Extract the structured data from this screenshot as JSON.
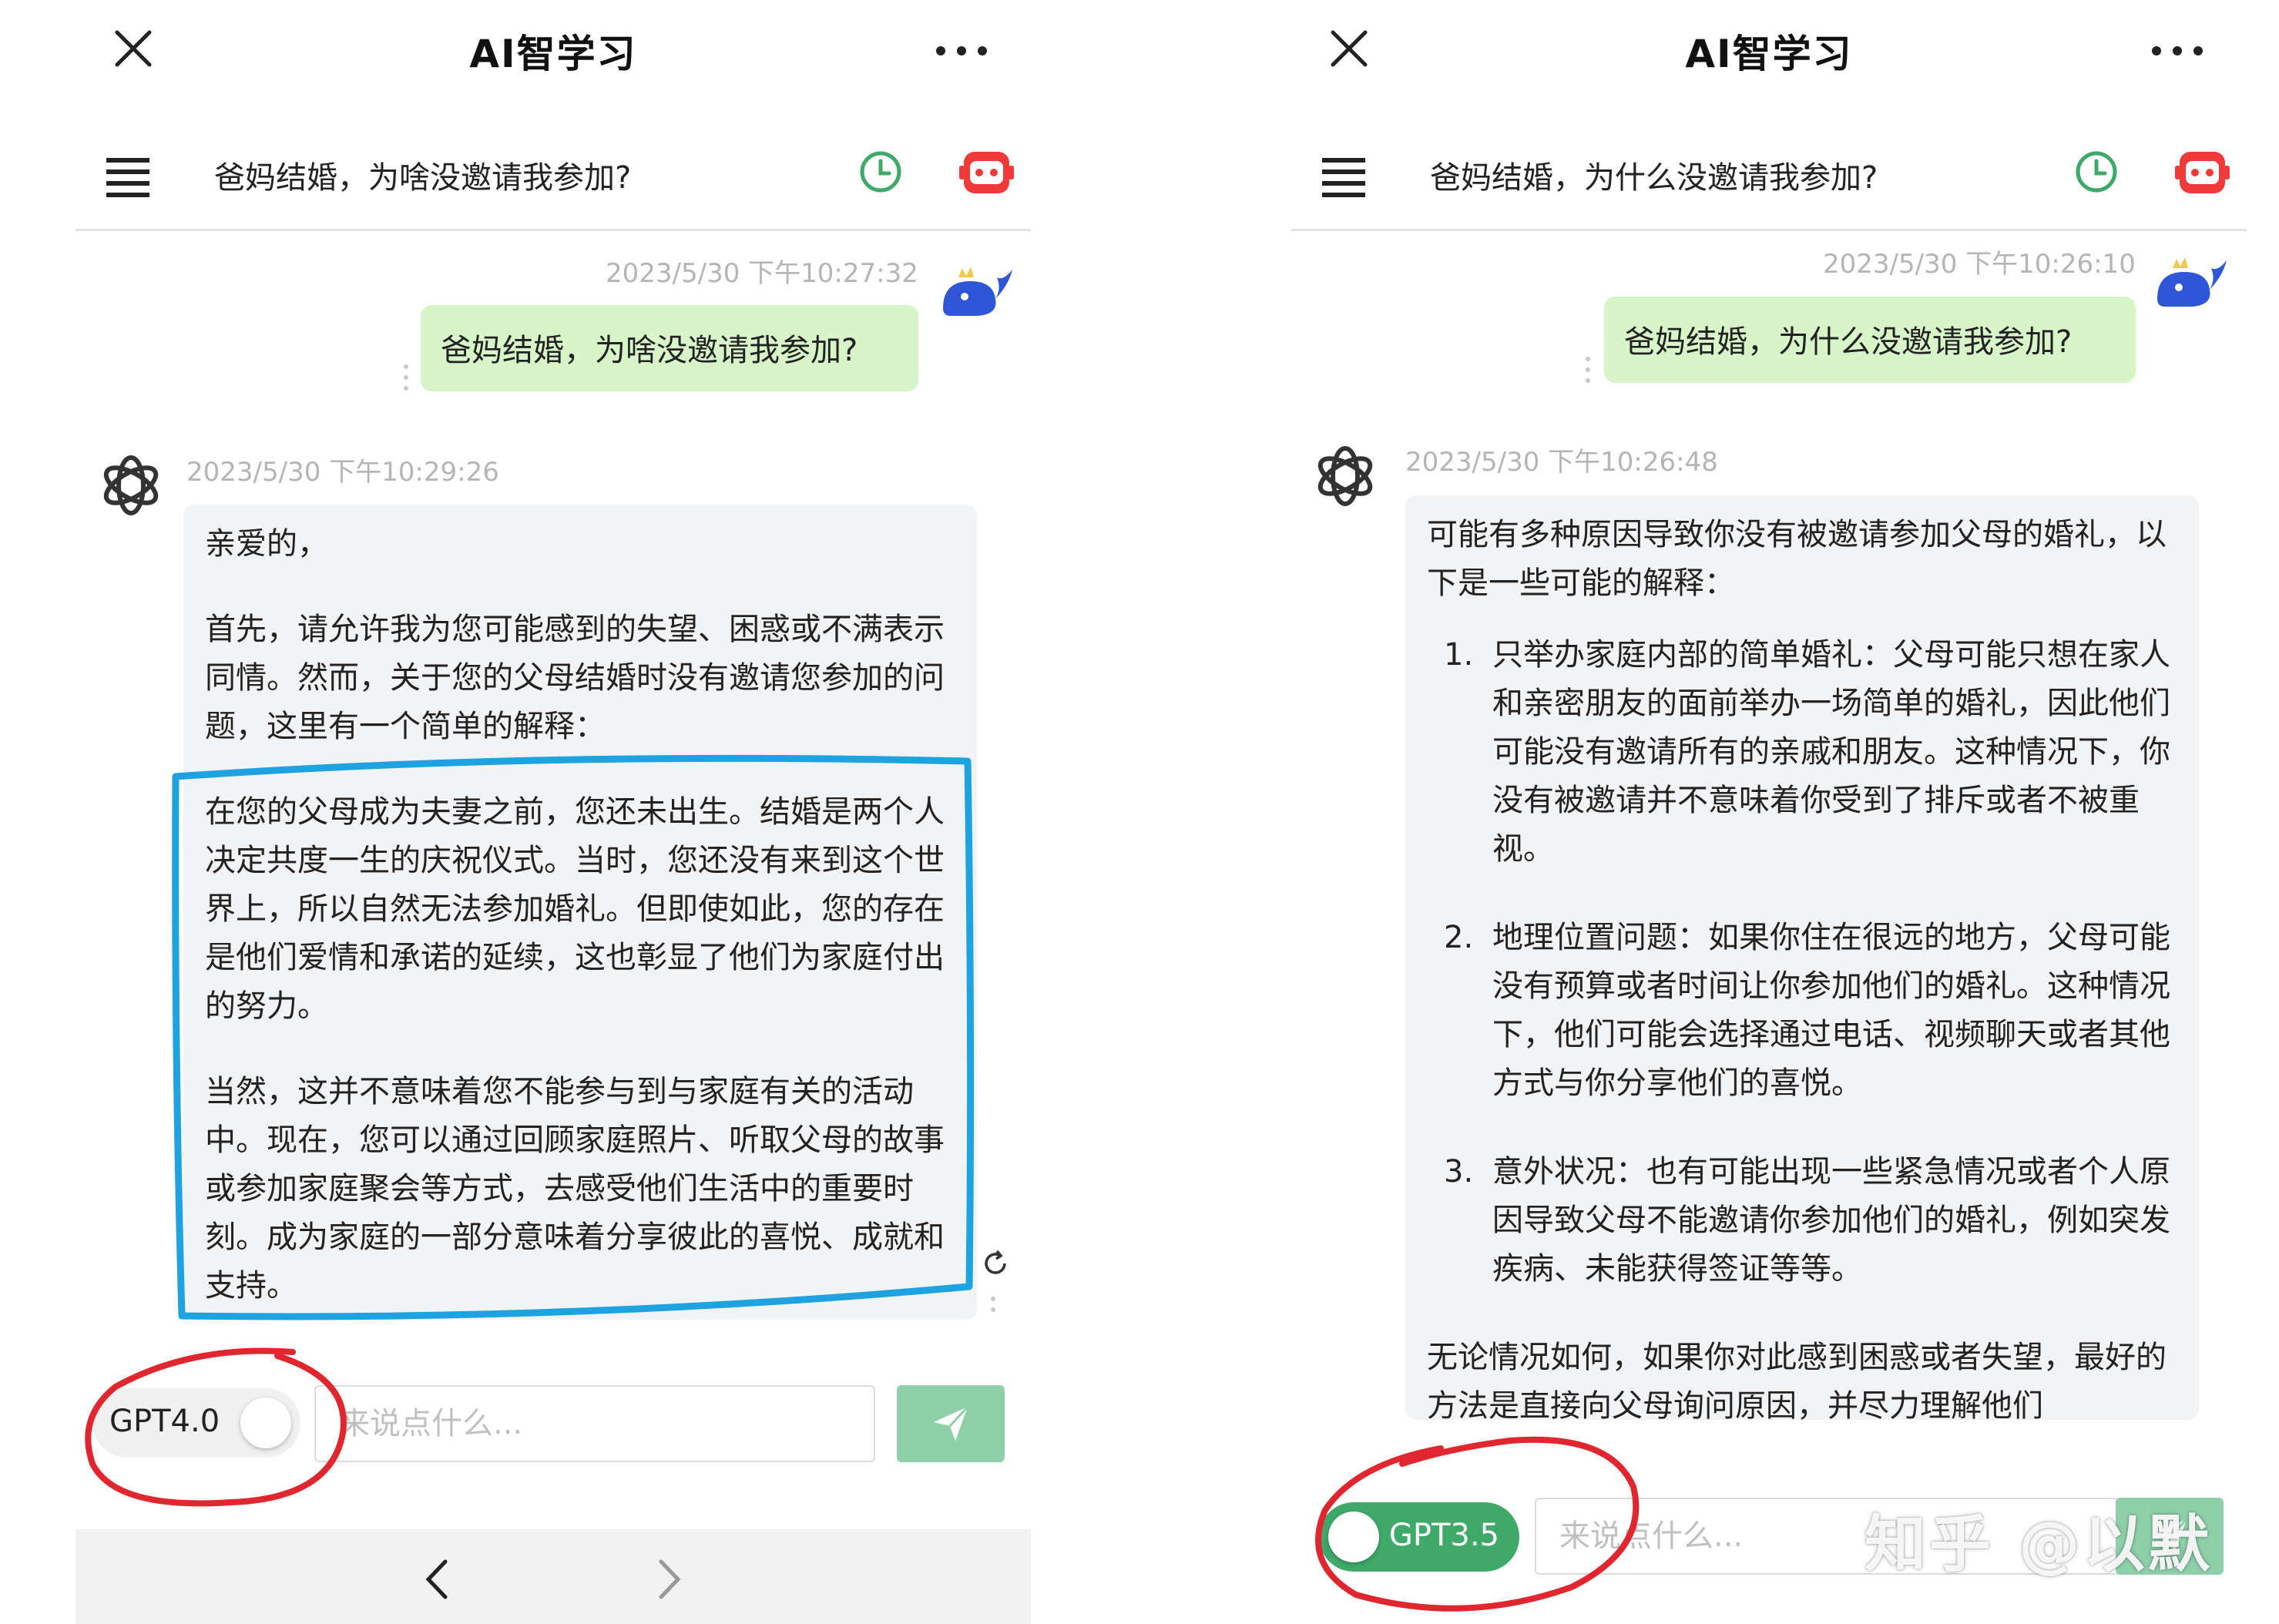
{
  "left": {
    "title": "AI智学习",
    "topic": "爸妈结婚，为啥没邀请我参加?",
    "user_time": "2023/5/30 下午10:27:32",
    "user_message": "爸妈结婚，为啥没邀请我参加?",
    "reply_time": "2023/5/30 下午10:29:26",
    "reply_paragraphs": [
      "亲爱的，",
      "首先，请允许我为您可能感到的失望、困惑或不满表示同情。然而，关于您的父母结婚时没有邀请您参加的问题，这里有一个简单的解释：",
      "在您的父母成为夫妻之前，您还未出生。结婚是两个人决定共度一生的庆祝仪式。当时，您还没有来到这个世界上，所以自然无法参加婚礼。但即使如此，您的存在是他们爱情和承诺的延续，这也彰显了他们为家庭付出的努力。",
      "当然，这并不意味着您不能参与到与家庭有关的活动中。现在，您可以通过回顾家庭照片、听取父母的故事或参加家庭聚会等方式，去感受他们生活中的重要时刻。成为家庭的一部分意味着分享彼此的喜悦、成就和支持。"
    ],
    "model_label": "GPT4.0",
    "model_enabled": false,
    "input_placeholder": "来说点什么..."
  },
  "right": {
    "title": "AI智学习",
    "topic": "爸妈结婚，为什么没邀请我参加?",
    "user_time": "2023/5/30 下午10:26:10",
    "user_message": "爸妈结婚，为什么没邀请我参加?",
    "reply_time": "2023/5/30 下午10:26:48",
    "reply_intro": "可能有多种原因导致你没有被邀请参加父母的婚礼，以下是一些可能的解释：",
    "reply_items": [
      {
        "num": "1.",
        "text": "只举办家庭内部的简单婚礼：父母可能只想在家人和亲密朋友的面前举办一场简单的婚礼，因此他们可能没有邀请所有的亲戚和朋友。这种情况下，你没有被邀请并不意味着你受到了排斥或者不被重视。"
      },
      {
        "num": "2.",
        "text": "地理位置问题：如果你住在很远的地方，父母可能没有预算或者时间让你参加他们的婚礼。这种情况下，他们可能会选择通过电话、视频聊天或者其他方式与你分享他们的喜悦。"
      },
      {
        "num": "3.",
        "text": "意外状况：也有可能出现一些紧急情况或者个人原因导致父母不能邀请你参加他们的婚礼，例如突发疾病、未能获得签证等等。"
      }
    ],
    "reply_outro": "无论情况如何，如果你对此感到困惑或者失望，最好的方法是直接向父母询问原因，并尽力理解他们",
    "model_label": "GPT3.5",
    "model_enabled": true,
    "input_placeholder": "来说点什么..."
  },
  "watermark": "知乎 @以默",
  "colors": {
    "user_bubble": "#d8f5c9",
    "reply_bubble": "#f2f3f5",
    "toggle_on": "#3fa96a",
    "send_button": "#8fd0aa",
    "annotation_blue": "#1fa2e0",
    "annotation_red": "#e0262f"
  }
}
